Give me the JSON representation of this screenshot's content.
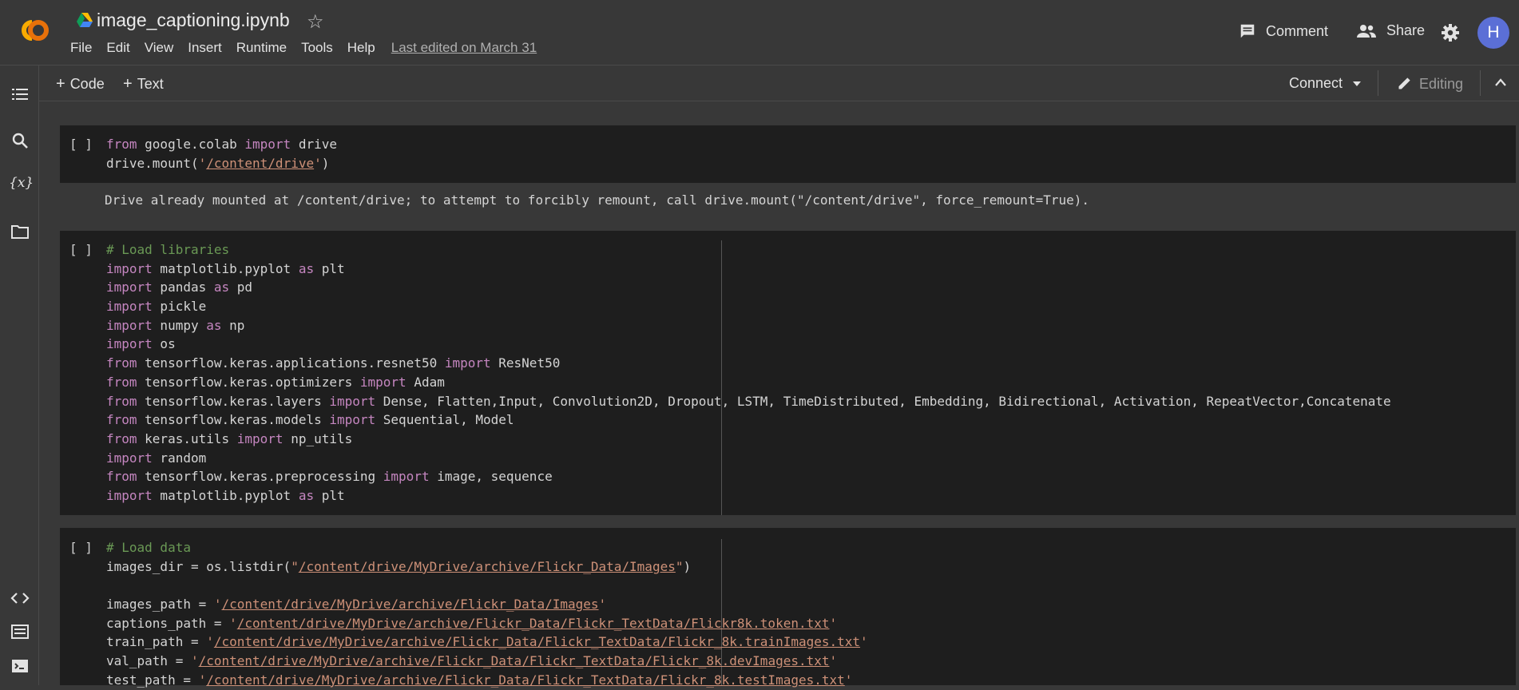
{
  "header": {
    "title": "image_captioning.ipynb",
    "menu": [
      "File",
      "Edit",
      "View",
      "Insert",
      "Runtime",
      "Tools",
      "Help"
    ],
    "last_edited": "Last edited on March 31",
    "comment_label": "Comment",
    "share_label": "Share",
    "avatar_letter": "H"
  },
  "toolbar": {
    "add_code": "Code",
    "add_text": "Text",
    "connect": "Connect",
    "editing": "Editing"
  },
  "cells": [
    {
      "bracket": "[ ]",
      "lines": [
        [
          [
            "kw",
            "from"
          ],
          [
            "t",
            " google.colab "
          ],
          [
            "kw",
            "import"
          ],
          [
            "t",
            " drive"
          ]
        ],
        [
          [
            "t",
            "drive.mount("
          ],
          [
            "q",
            "'"
          ],
          [
            "st",
            "/content/drive"
          ],
          [
            "q",
            "'"
          ],
          [
            "t",
            ")"
          ]
        ]
      ],
      "output": "Drive already mounted at /content/drive; to attempt to forcibly remount, call drive.mount(\"/content/drive\", force_remount=True)."
    },
    {
      "bracket": "[ ]",
      "lines": [
        [
          [
            "cm",
            "# Load libraries"
          ]
        ],
        [
          [
            "kw",
            "import"
          ],
          [
            "t",
            " matplotlib.pyplot "
          ],
          [
            "kw",
            "as"
          ],
          [
            "t",
            " plt"
          ]
        ],
        [
          [
            "kw",
            "import"
          ],
          [
            "t",
            " pandas "
          ],
          [
            "kw",
            "as"
          ],
          [
            "t",
            " pd"
          ]
        ],
        [
          [
            "kw",
            "import"
          ],
          [
            "t",
            " pickle"
          ]
        ],
        [
          [
            "kw",
            "import"
          ],
          [
            "t",
            " numpy "
          ],
          [
            "kw",
            "as"
          ],
          [
            "t",
            " np"
          ]
        ],
        [
          [
            "kw",
            "import"
          ],
          [
            "t",
            " os"
          ]
        ],
        [
          [
            "kw",
            "from"
          ],
          [
            "t",
            " tensorflow.keras.applications.resnet50 "
          ],
          [
            "kw",
            "import"
          ],
          [
            "t",
            " ResNet50"
          ]
        ],
        [
          [
            "kw",
            "from"
          ],
          [
            "t",
            " tensorflow.keras.optimizers "
          ],
          [
            "kw",
            "import"
          ],
          [
            "t",
            " Adam"
          ]
        ],
        [
          [
            "kw",
            "from"
          ],
          [
            "t",
            " tensorflow.keras.layers "
          ],
          [
            "kw",
            "import"
          ],
          [
            "t",
            " Dense, Flatten,Input, Convolution2D, Dropout, LSTM, TimeDistributed, Embedding, Bidirectional, Activation, RepeatVector,Concatenate"
          ]
        ],
        [
          [
            "kw",
            "from"
          ],
          [
            "t",
            " tensorflow.keras.models "
          ],
          [
            "kw",
            "import"
          ],
          [
            "t",
            " Sequential, Model"
          ]
        ],
        [
          [
            "kw",
            "from"
          ],
          [
            "t",
            " keras.utils "
          ],
          [
            "kw",
            "import"
          ],
          [
            "t",
            " np_utils"
          ]
        ],
        [
          [
            "kw",
            "import"
          ],
          [
            "t",
            " random"
          ]
        ],
        [
          [
            "kw",
            "from"
          ],
          [
            "t",
            " tensorflow.keras.preprocessing "
          ],
          [
            "kw",
            "import"
          ],
          [
            "t",
            " image, sequence"
          ]
        ],
        [
          [
            "kw",
            "import"
          ],
          [
            "t",
            " matplotlib.pyplot "
          ],
          [
            "kw",
            "as"
          ],
          [
            "t",
            " plt"
          ]
        ]
      ]
    },
    {
      "bracket": "[ ]",
      "lines": [
        [
          [
            "cm",
            "# Load data"
          ]
        ],
        [
          [
            "t",
            "images_dir = os.listdir("
          ],
          [
            "q",
            "\""
          ],
          [
            "st",
            "/content/drive/MyDrive/archive/Flickr_Data/Images"
          ],
          [
            "q",
            "\""
          ],
          [
            "t",
            ")"
          ]
        ],
        [
          [
            "t",
            ""
          ]
        ],
        [
          [
            "t",
            "images_path = "
          ],
          [
            "q",
            "'"
          ],
          [
            "st",
            "/content/drive/MyDrive/archive/Flickr_Data/Images"
          ],
          [
            "q",
            "'"
          ]
        ],
        [
          [
            "t",
            "captions_path = "
          ],
          [
            "q",
            "'"
          ],
          [
            "st",
            "/content/drive/MyDrive/archive/Flickr_Data/Flickr_TextData/Flickr8k.token.txt"
          ],
          [
            "q",
            "'"
          ]
        ],
        [
          [
            "t",
            "train_path = "
          ],
          [
            "q",
            "'"
          ],
          [
            "st",
            "/content/drive/MyDrive/archive/Flickr_Data/Flickr_TextData/Flickr_8k.trainImages.txt"
          ],
          [
            "q",
            "'"
          ]
        ],
        [
          [
            "t",
            "val_path = "
          ],
          [
            "q",
            "'"
          ],
          [
            "st",
            "/content/drive/MyDrive/archive/Flickr_Data/Flickr_TextData/Flickr_8k.devImages.txt"
          ],
          [
            "q",
            "'"
          ]
        ],
        [
          [
            "t",
            "test_path = "
          ],
          [
            "q",
            "'"
          ],
          [
            "st",
            "/content/drive/MyDrive/archive/Flickr_Data/Flickr_TextData/Flickr_8k.testImages.txt"
          ],
          [
            "q",
            "'"
          ]
        ]
      ]
    }
  ],
  "colors": {
    "background": "#383838",
    "cell_bg": "#1e1e1e",
    "keyword": "#c586c0",
    "comment": "#6a9955",
    "string": "#ce9178",
    "avatar": "#5b6fd6",
    "logo_orange": "#f9ab00"
  },
  "icons": [
    "colab-logo-icon",
    "drive-icon",
    "star-icon",
    "comment-icon",
    "share-icon",
    "gear-icon",
    "toc-icon",
    "search-icon",
    "variables-icon",
    "folder-icon",
    "code-snippets-icon",
    "command-palette-icon",
    "terminal-icon",
    "pencil-icon",
    "chevron-down-icon",
    "chevron-up-icon"
  ]
}
